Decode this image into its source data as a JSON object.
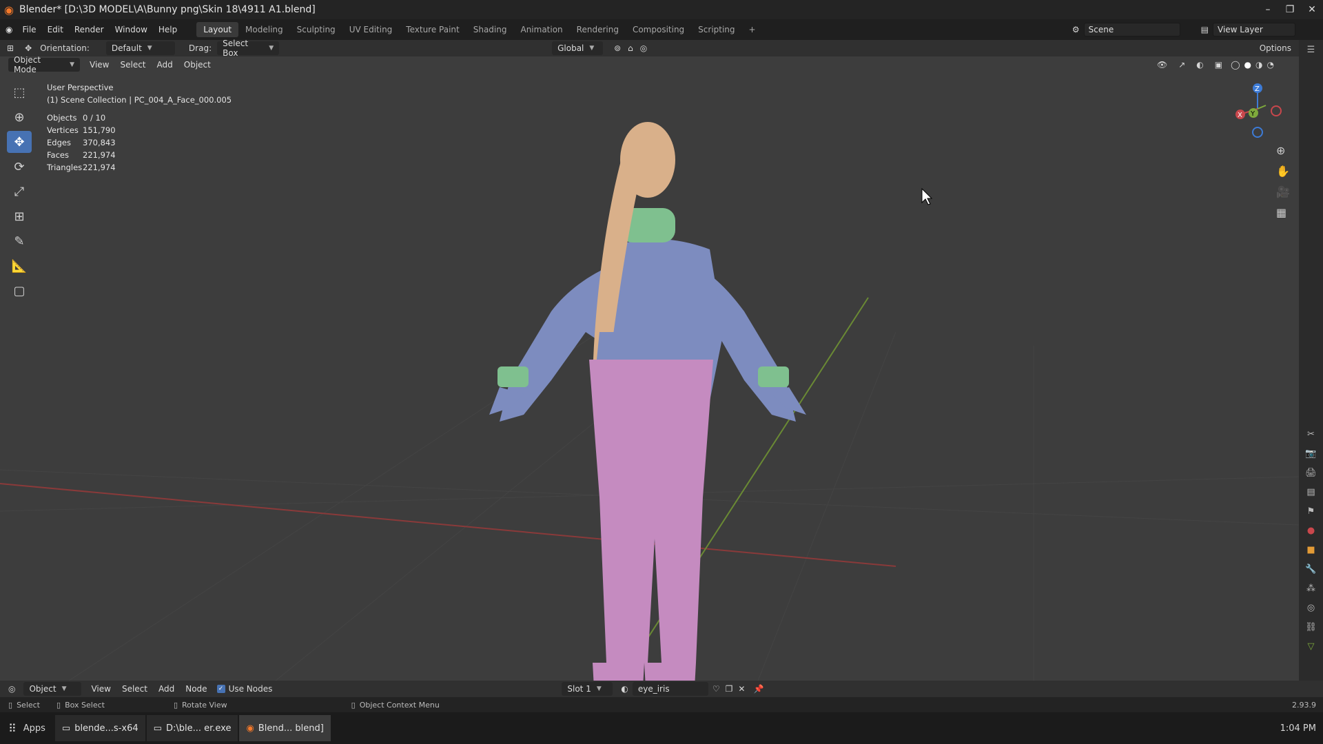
{
  "title": "Blender* [D:\\3D MODEL\\A\\Bunny png\\Skin 18\\4911 A1.blend]",
  "menus": [
    "File",
    "Edit",
    "Render",
    "Window",
    "Help"
  ],
  "workspaces": [
    "Layout",
    "Modeling",
    "Sculpting",
    "UV Editing",
    "Texture Paint",
    "Shading",
    "Animation",
    "Rendering",
    "Compositing",
    "Scripting"
  ],
  "active_workspace": "Layout",
  "scene": "Scene",
  "view_layer": "View Layer",
  "toolbar": {
    "orientation_label": "Orientation:",
    "orientation_value": "Default",
    "drag_label": "Drag:",
    "drag_value": "Select Box",
    "transform_orient": "Global",
    "options": "Options"
  },
  "viewport_header": {
    "mode": "Object Mode",
    "menus": [
      "View",
      "Select",
      "Add",
      "Object"
    ]
  },
  "overlay": {
    "view_name": "User Perspective",
    "collection": "(1) Scene Collection | PC_004_A_Face_000.005",
    "stats": [
      {
        "k": "Objects",
        "v": "0 / 10"
      },
      {
        "k": "Vertices",
        "v": "151,790"
      },
      {
        "k": "Edges",
        "v": "370,843"
      },
      {
        "k": "Faces",
        "v": "221,974"
      },
      {
        "k": "Triangles",
        "v": "221,974"
      }
    ]
  },
  "gizmo": {
    "x": "X",
    "y": "Y",
    "z": "Z"
  },
  "node_header": {
    "editor": "Object",
    "menus": [
      "View",
      "Select",
      "Add",
      "Node"
    ],
    "use_nodes": "Use Nodes",
    "slot": "Slot 1",
    "material": "eye_iris"
  },
  "status_bar": {
    "select": "Select",
    "box_select": "Box Select",
    "rotate": "Rotate View",
    "context": "Object Context Menu",
    "version": "2.93.9"
  },
  "taskbar": {
    "apps": "Apps",
    "tasks": [
      "blende...s-x64",
      "D:\\ble... er.exe",
      "Blend... blend]"
    ],
    "time": "1:04 PM"
  },
  "colors": {
    "accent": "#4772b3",
    "axis_x": "#c9474c",
    "axis_y": "#7eaa3c",
    "axis_z": "#3d7bd6",
    "shirt": "#7d8cbf",
    "pants": "#c58bc0",
    "hair": "#d9b08a",
    "accents": "#7fc08f"
  }
}
